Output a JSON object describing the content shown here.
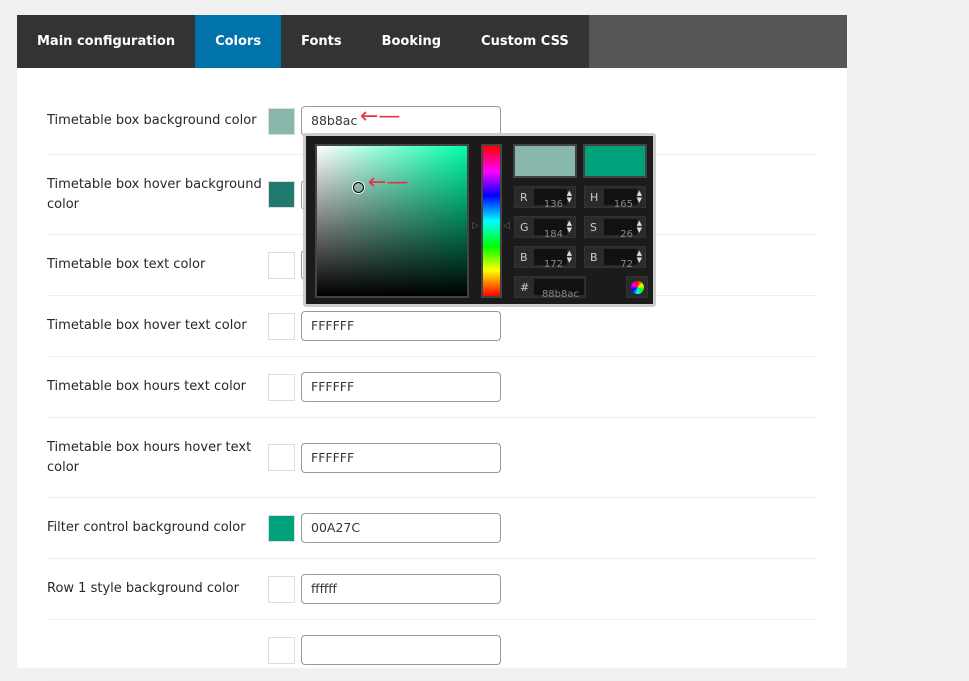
{
  "tabs": [
    {
      "label": "Main configuration"
    },
    {
      "label": "Colors",
      "active": true
    },
    {
      "label": "Fonts"
    },
    {
      "label": "Booking"
    },
    {
      "label": "Custom CSS"
    }
  ],
  "rows": [
    {
      "label": "Timetable box background color",
      "value": "88b8ac",
      "swatch": "#88b8ac"
    },
    {
      "label": "Timetable box hover background color",
      "value": "",
      "swatch": "#217a6e"
    },
    {
      "label": "Timetable box text color",
      "value": "",
      "swatch": "#ffffff"
    },
    {
      "label": "Timetable box hover text color",
      "value": "FFFFFF",
      "swatch": "#ffffff"
    },
    {
      "label": "Timetable box hours text color",
      "value": "FFFFFF",
      "swatch": "#ffffff"
    },
    {
      "label": "Timetable box hours hover text color",
      "value": "FFFFFF",
      "swatch": "#ffffff"
    },
    {
      "label": "Filter control background color",
      "value": "00A27C",
      "swatch": "#00a27c"
    },
    {
      "label": "Row 1 style background color",
      "value": "ffffff",
      "swatch": "#ffffff"
    },
    {
      "label": "",
      "value": "",
      "swatch": "#ffffff"
    }
  ],
  "picker": {
    "new_color": "#88b8ac",
    "current_color": "#00a27c",
    "r": "136",
    "g": "184",
    "b": "172",
    "h": "165",
    "s": "26",
    "br": "72",
    "hex": "88b8ac",
    "labels": {
      "r": "R",
      "g": "G",
      "b": "B",
      "h": "H",
      "s": "S",
      "br": "B",
      "hex": "#"
    }
  },
  "colors": {
    "accent": "#0073aa",
    "annotation_arrow": "#e5334f"
  }
}
